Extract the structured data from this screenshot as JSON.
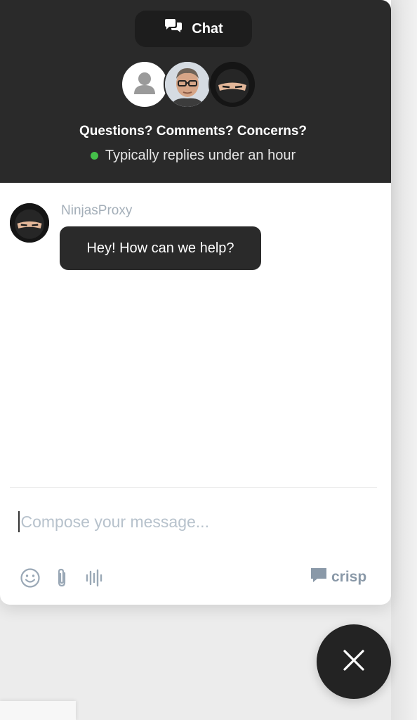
{
  "header": {
    "chat_label": "Chat",
    "title": "Questions? Comments? Concerns?",
    "status": "Typically replies under an hour",
    "status_color": "#45c04a",
    "avatars": [
      "default-user-icon",
      "operator-photo",
      "ninja-avatar"
    ]
  },
  "conversation": {
    "sender": "NinjasProxy",
    "message": "Hey! How can we help?"
  },
  "composer": {
    "placeholder": "Compose your message...",
    "tools": [
      "emoji-icon",
      "attachment-icon",
      "audio-icon"
    ]
  },
  "branding": {
    "label": "crisp"
  },
  "colors": {
    "header_bg": "#2a2a2a",
    "bubble_bg": "#2a2a2a",
    "close_button_bg": "#232323"
  }
}
